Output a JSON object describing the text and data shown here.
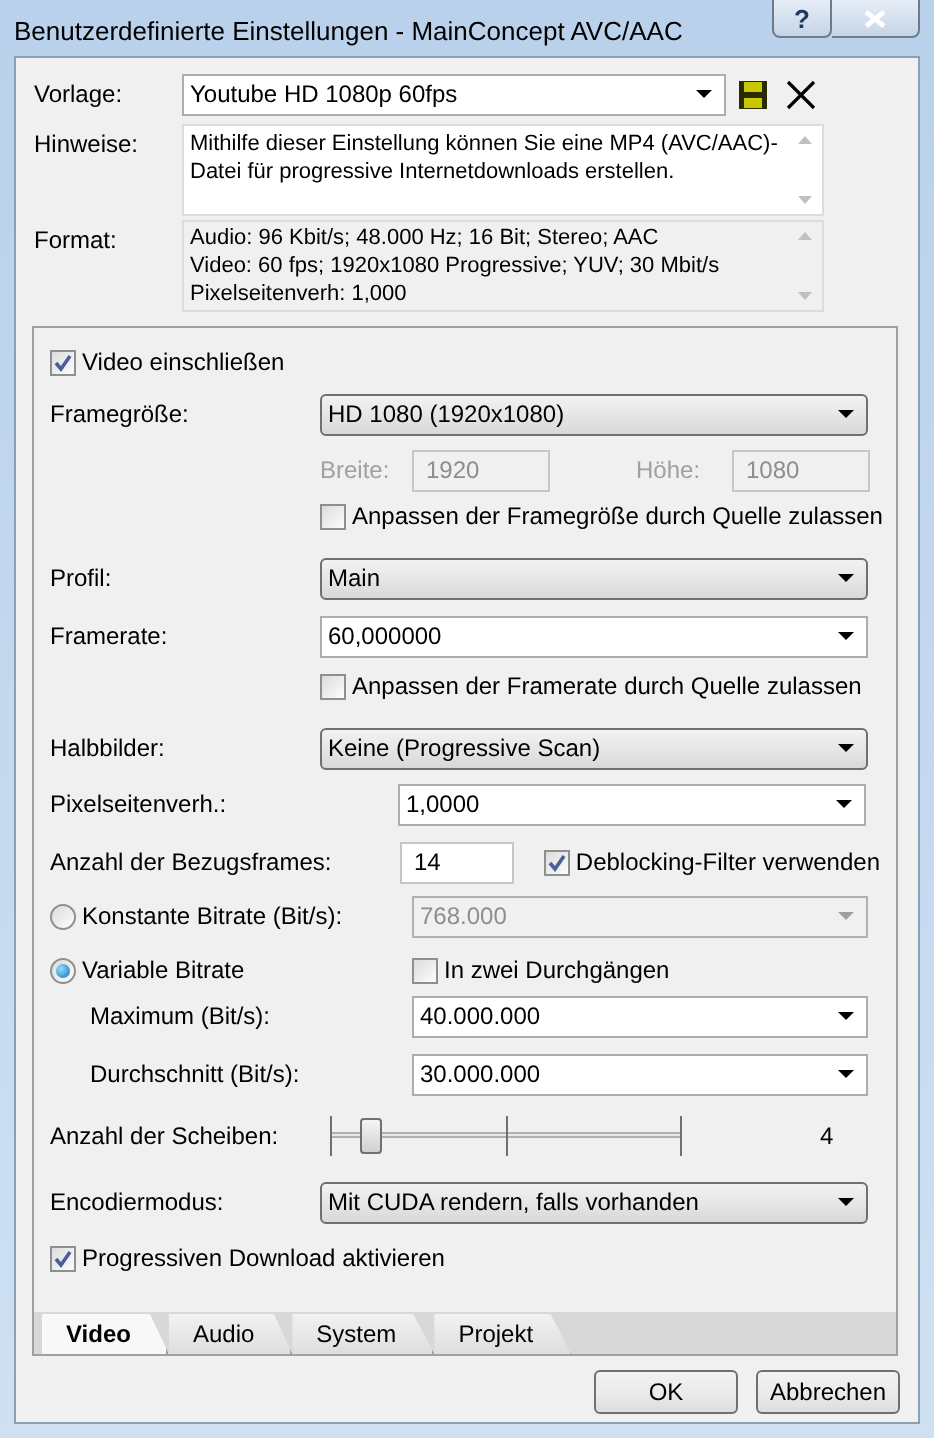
{
  "window": {
    "title": "Benutzerdefinierte Einstellungen - MainConcept AVC/AAC",
    "help_glyph": "?"
  },
  "vorlage": {
    "label": "Vorlage:",
    "value": "Youtube HD 1080p 60fps"
  },
  "hinweise": {
    "label": "Hinweise:",
    "text": "Mithilfe dieser Einstellung können Sie eine MP4 (AVC/AAC)-Datei für progressive Internetdownloads erstellen."
  },
  "format": {
    "label": "Format:",
    "lines": [
      "Audio: 96 Kbit/s; 48.000 Hz; 16 Bit; Stereo; AAC",
      "Video: 60 fps; 1920x1080 Progressive; YUV; 30 Mbit/s",
      "Pixelseitenverh: 1,000"
    ]
  },
  "video_include": {
    "label": "Video einschließen",
    "checked": true
  },
  "frame_size": {
    "label": "Framegröße:",
    "value": "HD 1080 (1920x1080)"
  },
  "width": {
    "label": "Breite:",
    "value": "1920",
    "disabled": true
  },
  "height": {
    "label": "Höhe:",
    "value": "1080",
    "disabled": true
  },
  "frame_size_from_source": {
    "label": "Anpassen der Framegröße durch Quelle zulassen",
    "checked": false
  },
  "profile": {
    "label": "Profil:",
    "value": "Main"
  },
  "framerate": {
    "label": "Framerate:",
    "value": "60,000000"
  },
  "framerate_from_source": {
    "label": "Anpassen der Framerate durch Quelle zulassen",
    "checked": false
  },
  "fields": {
    "label": "Halbbilder:",
    "value": "Keine (Progressive Scan)"
  },
  "pixel_aspect": {
    "label": "Pixelseitenverh.:",
    "value": "1,0000"
  },
  "reference_frames": {
    "label": "Anzahl der Bezugsframes:",
    "value": "14"
  },
  "deblocking": {
    "label": "Deblocking-Filter verwenden",
    "checked": true
  },
  "bitrate_modes": [
    {
      "label": "Konstante Bitrate (Bit/s):",
      "selected": false
    },
    {
      "label": "Variable Bitrate",
      "selected": true
    }
  ],
  "constant_bitrate": {
    "value": "768.000",
    "disabled": true
  },
  "two_pass": {
    "label": "In zwei Durchgängen",
    "checked": false
  },
  "maximum": {
    "label": "Maximum (Bit/s):",
    "value": "40.000.000"
  },
  "average": {
    "label": "Durchschnitt (Bit/s):",
    "value": "30.000.000"
  },
  "slices": {
    "label": "Anzahl der Scheiben:",
    "level": 0.09,
    "reading": "4"
  },
  "encode_mode": {
    "label": "Encodiermodus:",
    "value": "Mit CUDA rendern, falls vorhanden"
  },
  "progressive_download": {
    "label": "Progressiven Download aktivieren",
    "checked": true
  },
  "tabs": [
    {
      "label": "Video",
      "selected": true
    },
    {
      "label": "Audio",
      "selected": false
    },
    {
      "label": "System",
      "selected": false
    },
    {
      "label": "Projekt",
      "selected": false
    }
  ],
  "buttons": [
    "OK",
    "Abbrechen"
  ]
}
